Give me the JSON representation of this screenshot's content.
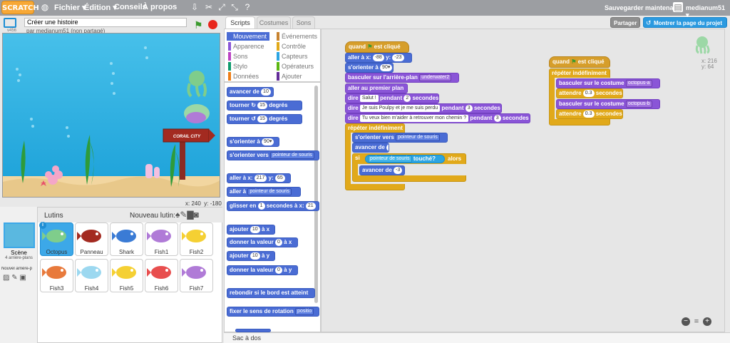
{
  "menu": {
    "logo": "SCRATCH",
    "file": "Fichier ▾",
    "edit": "Édition ▾",
    "tips": "Conseils",
    "about": "À propos",
    "save_now": "Sauvegarder maintenant",
    "user": "medianum51 ▾"
  },
  "project": {
    "title": "Créer une histoire",
    "byline": "par medianum51 (non partagé)",
    "share": "Partager",
    "see_page": "Montrer la page du projet",
    "stage_size_label": "v456"
  },
  "stage": {
    "coords_x_label": "x:",
    "coords_x": "240",
    "coords_y_label": "y:",
    "coords_y": "-180",
    "sign_text": "CORAIL CITY"
  },
  "tabs": {
    "scripts": "Scripts",
    "costumes": "Costumes",
    "sounds": "Sons"
  },
  "categories": [
    {
      "label": "Mouvement",
      "color": "#4a6cd4"
    },
    {
      "label": "Apparence",
      "color": "#8a55d7"
    },
    {
      "label": "Sons",
      "color": "#bb42c3"
    },
    {
      "label": "Stylo",
      "color": "#0e9a6c"
    },
    {
      "label": "Données",
      "color": "#ee7d16"
    },
    {
      "label": "Événements",
      "color": "#c88330"
    },
    {
      "label": "Contrôle",
      "color": "#e1a91a"
    },
    {
      "label": "Capteurs",
      "color": "#2ca5e2"
    },
    {
      "label": "Opérateurs",
      "color": "#5cb712"
    },
    {
      "label": "Ajouter blocs",
      "color": "#632d99"
    }
  ],
  "palette": {
    "move": "avancer de",
    "move_n": "10",
    "turn_r": "tourner",
    "turn_r_n": "15",
    "degrees": "degrés",
    "turn_l": "tourner",
    "turn_l_n": "15",
    "point_dir": "s'orienter à",
    "point_dir_n": "90▾",
    "point_to": "s'orienter vers",
    "point_to_v": "pointeur de souris",
    "goto_xy": "aller à x:",
    "goto_x": "217",
    "goto_y_lbl": "y:",
    "goto_y": "65",
    "goto": "aller à",
    "goto_v": "pointeur de souris",
    "glide": "glisser en",
    "glide_n": "1",
    "glide_sec": "secondes à x:",
    "glide_x": "21",
    "add_x": "ajouter",
    "add_x_n": "10",
    "add_x_lbl": "à x",
    "set_x": "donner la valeur",
    "set_x_n": "0",
    "set_x_lbl": "à x",
    "add_y": "ajouter",
    "add_y_n": "10",
    "add_y_lbl": "à y",
    "set_y": "donner la valeur",
    "set_y_n": "0",
    "set_y_lbl": "à y",
    "bounce": "rebondir si le bord est atteint",
    "rotation": "fixer le sens de rotation",
    "rotation_v": "positio"
  },
  "script1": {
    "hat": "quand",
    "hat_after": "est cliqué",
    "goto": "aller à x:",
    "x": "-88",
    "y_lbl": "y:",
    "y": "-23",
    "point": "s'orienter à",
    "dir": "90▾",
    "backdrop": "basculer sur l'arrière-plan",
    "backdrop_v": "underwater2",
    "front": "aller au premier plan",
    "say1": "dire",
    "say1_v": "Salut !",
    "say1_mid": "pendant",
    "say1_n": "2",
    "say1_end": "secondes",
    "say2": "dire",
    "say2_v": "Je suis Poulpy et je me suis perdu",
    "say2_mid": "pendant",
    "say2_n": "3",
    "say2_end": "secondes",
    "say3": "dire",
    "say3_v": "Tu veux bien m'aider à retrouver mon chemin ?",
    "say3_mid": "pendant",
    "say3_n": "3",
    "say3_end": "secondes",
    "forever": "répéter indéfiniment",
    "point_to": "s'orienter vers",
    "point_to_v": "pointeur de souris",
    "move": "avancer de",
    "move_n": "3",
    "if": "si",
    "touch_v": "pointeur de souris",
    "touching": "touché?",
    "then": "alors",
    "move2": "avancer de",
    "move2_n": "-3"
  },
  "script2": {
    "hat": "quand",
    "hat_after": "est cliqué",
    "forever": "répéter indéfiniment",
    "costume1": "basculer sur le costume",
    "costume1_v": "octopus-a",
    "wait1": "attendre",
    "wait1_n": "0.3",
    "wait1_end": "secondes",
    "costume2": "basculer sur le costume",
    "costume2_v": "octopus-b",
    "wait2": "attendre",
    "wait2_n": "0.3",
    "wait2_end": "secondes"
  },
  "sprite_info": {
    "x_lbl": "x:",
    "x": "216",
    "y_lbl": "y:",
    "y": "64"
  },
  "sprites_pane": {
    "title": "Lutins",
    "new_sprite": "Nouveau lutin:",
    "scene": "Scène",
    "scene_sub": "4 arrière-plans",
    "new_backdrop": "Nouvel arrière-p"
  },
  "sprites": [
    {
      "name": "Octopus",
      "selected": true
    },
    {
      "name": "Panneau",
      "selected": false
    },
    {
      "name": "Shark",
      "selected": false
    },
    {
      "name": "Fish1",
      "selected": false
    },
    {
      "name": "Fish2",
      "selected": false
    },
    {
      "name": "Fish3",
      "selected": false
    },
    {
      "name": "Fish4",
      "selected": false
    },
    {
      "name": "Fish5",
      "selected": false
    },
    {
      "name": "Fish6",
      "selected": false
    },
    {
      "name": "Fish7",
      "selected": false
    }
  ],
  "backpack": "Sac à dos",
  "zoom": {
    "out": "−",
    "reset": "=",
    "in": "+"
  }
}
